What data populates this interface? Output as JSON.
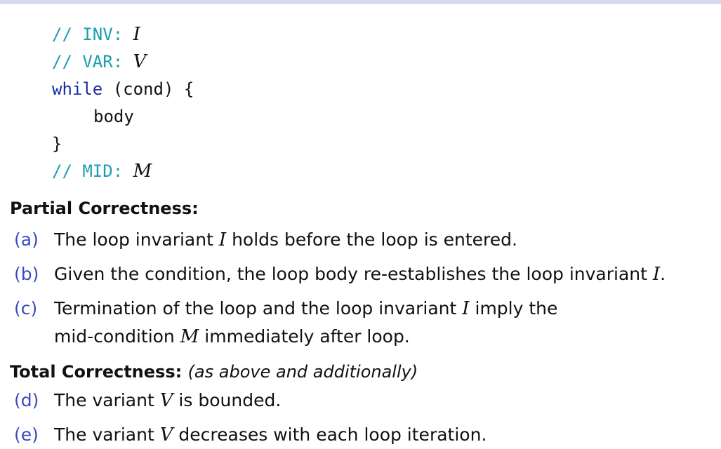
{
  "code": {
    "inv_comment": "// INV: ",
    "inv_symbol": "I",
    "var_comment": "// VAR: ",
    "var_symbol": "V",
    "while_kw": "while",
    "while_rest": " (cond) {",
    "body": "body",
    "close_brace": "}",
    "mid_comment": "// MID: ",
    "mid_symbol": "M"
  },
  "partial": {
    "heading": "Partial Correctness:",
    "items": [
      {
        "label": "(a)",
        "pre": "The loop invariant ",
        "sym": "I",
        "post": " holds before the loop is entered."
      },
      {
        "label": "(b)",
        "pre": "Given the condition, the loop body re-establishes the loop invariant ",
        "sym": "I",
        "post": "."
      },
      {
        "label": "(c)",
        "pre": "Termination of the loop and the loop invariant ",
        "sym": "I",
        "post": " imply the",
        "pre2": "mid-condition ",
        "sym2": "M",
        "post2": " immediately after loop."
      }
    ]
  },
  "total": {
    "heading": "Total Correctness:",
    "note": "(as above and additionally)",
    "items": [
      {
        "label": "(d)",
        "pre": "The variant ",
        "sym": "V",
        "post": " is bounded."
      },
      {
        "label": "(e)",
        "pre": "The variant ",
        "sym": "V",
        "post": " decreases with each loop iteration."
      }
    ]
  },
  "colors": {
    "comment": "#1a9fb0",
    "keyword": "#1a2fa0",
    "item_label": "#3a4cc0",
    "top_bar": "#d6d8ef"
  }
}
